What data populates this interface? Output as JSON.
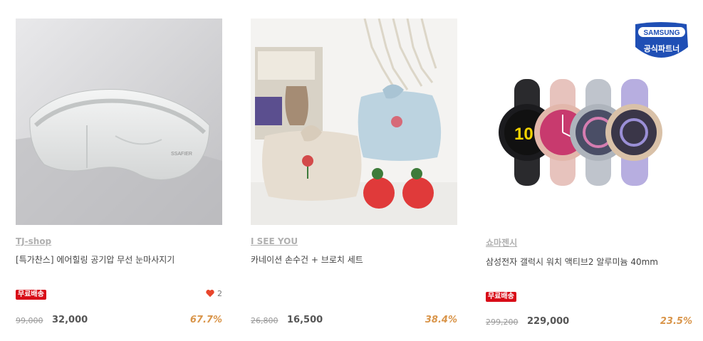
{
  "products": [
    {
      "shop": "TJ-shop",
      "title": "[특가찬스] 에어힐링 공기압 무선 눈마사지기",
      "badge": "무료배송",
      "likes": "2",
      "original_price": "99,000",
      "sale_price": "32,000",
      "discount": "67.7%",
      "image_icon": "eye-massager-image"
    },
    {
      "shop": "I SEE YOU",
      "title": "카네이션 손수건 + 브로치 세트",
      "original_price": "26,800",
      "sale_price": "16,500",
      "discount": "38.4%",
      "image_icon": "carnation-handkerchief-image"
    },
    {
      "shop": "쇼마젠시",
      "title": "삼성전자 갤럭시 워치 액티브2 알루미늄 40mm",
      "badge": "무료배송",
      "original_price": "299,200",
      "sale_price": "229,000",
      "discount": "23.5%",
      "image_icon": "galaxy-watch-image",
      "partner_badge": {
        "brand": "SAMSUNG",
        "label": "공식파트너"
      },
      "watch_face_number": "10"
    }
  ],
  "colors": {
    "free_shipping_badge": "#d80c18",
    "discount": "#d9954a",
    "heart": "#e8452c",
    "shop_link": "#b0b0b0",
    "samsung_blue": "#1f4fb5"
  }
}
